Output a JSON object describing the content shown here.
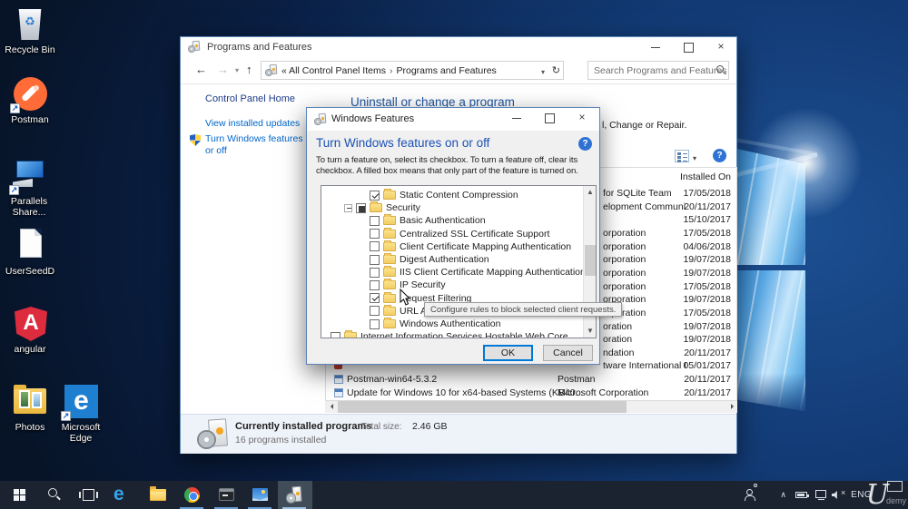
{
  "desktop": {
    "icons": [
      {
        "label": "Recycle Bin",
        "icon": "recycle-bin",
        "shortcut": false
      },
      {
        "label": "Postman",
        "icon": "postman",
        "shortcut": true
      },
      {
        "label": "Parallels Share...",
        "icon": "parallels",
        "shortcut": true
      },
      {
        "label": "UserSeedD",
        "icon": "document",
        "shortcut": false
      },
      {
        "label": "angular",
        "icon": "angular",
        "shortcut": false
      },
      {
        "label": "Photos",
        "icon": "photos",
        "shortcut": false
      },
      {
        "label": "Microsoft Edge",
        "icon": "edge",
        "shortcut": true
      }
    ]
  },
  "window": {
    "title": "Programs and Features",
    "nav": {
      "breadcrumb_root": "« All Control Panel Items",
      "breadcrumb_sep": "›",
      "breadcrumb_current": "Programs and Features",
      "search_placeholder": "Search Programs and Features"
    },
    "sidebar": {
      "home": "Control Panel Home",
      "view_updates": "View installed updates",
      "turn_features": "Turn Windows features on or off"
    },
    "main": {
      "heading": "Uninstall or change a program",
      "uninstall_hint_fragment": "l, Change or Repair.",
      "installed_on": "Installed On",
      "rows": [
        {
          "publisher": "for SQLite Team",
          "date": "17/05/2018",
          "icon": null,
          "name": ""
        },
        {
          "publisher": "elopment Communi",
          "date": "20/11/2017",
          "icon": null,
          "name": ""
        },
        {
          "publisher": "",
          "date": "15/10/2017",
          "icon": null,
          "name": ""
        },
        {
          "publisher": "orporation",
          "date": "17/05/2018",
          "icon": null,
          "name": ""
        },
        {
          "publisher": "orporation",
          "date": "04/06/2018",
          "icon": null,
          "name": ""
        },
        {
          "publisher": "orporation",
          "date": "19/07/2018",
          "icon": null,
          "name": ""
        },
        {
          "publisher": "orporation",
          "date": "19/07/2018",
          "icon": null,
          "name": ""
        },
        {
          "publisher": "orporation",
          "date": "17/05/2018",
          "icon": null,
          "name": ""
        },
        {
          "publisher": "orporation",
          "date": "19/07/2018",
          "icon": null,
          "name": ""
        },
        {
          "publisher": "orporation",
          "date": "17/05/2018",
          "icon": null,
          "name": ""
        },
        {
          "publisher": "oration",
          "date": "19/07/2018",
          "icon": null,
          "name": ""
        },
        {
          "publisher": "oration",
          "date": "19/07/2018",
          "icon": null,
          "name": ""
        },
        {
          "publisher": "ndation",
          "date": "20/11/2017",
          "icon": null,
          "name": ""
        },
        {
          "publisher": "tware International I",
          "date": "05/01/2017",
          "icon": "red",
          "name": ""
        },
        {
          "publisher": "Postman",
          "date": "20/11/2017",
          "icon": "app",
          "name": "Postman-win64-5.3.2"
        },
        {
          "publisher": "Microsoft Corporation",
          "date": "20/11/2017",
          "icon": "app",
          "name": "Update for Windows 10 for x64-based Systems (KB40..."
        }
      ],
      "footer": {
        "title": "Currently installed programs",
        "size_label": "Total size:",
        "size_value": "2.46 GB",
        "count": "16 programs installed"
      }
    }
  },
  "dialog": {
    "title": "Windows Features",
    "heading": "Turn Windows features on or off",
    "help": "?",
    "description": "To turn a feature on, select its checkbox. To turn a feature off, clear its checkbox. A filled box means that only part of the feature is turned on.",
    "tree": [
      {
        "label": "Static Content Compression",
        "level": 2,
        "state": "checked",
        "expander": null
      },
      {
        "label": "Security",
        "level": 1,
        "state": "partial",
        "expander": "minus"
      },
      {
        "label": "Basic Authentication",
        "level": 2,
        "state": "unchecked",
        "expander": null
      },
      {
        "label": "Centralized SSL Certificate Support",
        "level": 2,
        "state": "unchecked",
        "expander": null
      },
      {
        "label": "Client Certificate Mapping Authentication",
        "level": 2,
        "state": "unchecked",
        "expander": null
      },
      {
        "label": "Digest Authentication",
        "level": 2,
        "state": "unchecked",
        "expander": null
      },
      {
        "label": "IIS Client Certificate Mapping Authentication",
        "level": 2,
        "state": "unchecked",
        "expander": null
      },
      {
        "label": "IP Security",
        "level": 2,
        "state": "unchecked",
        "expander": null
      },
      {
        "label": "Request Filtering",
        "level": 2,
        "state": "checked",
        "expander": null
      },
      {
        "label": "URL Authorization",
        "level": 2,
        "state": "unchecked",
        "expander": null
      },
      {
        "label": "Windows Authentication",
        "level": 2,
        "state": "unchecked",
        "expander": null
      },
      {
        "label": "Internet Information Services Hostable Web Core",
        "level": 0,
        "state": "unchecked",
        "expander": null
      }
    ],
    "buttons": {
      "ok": "OK",
      "cancel": "Cancel"
    }
  },
  "tooltip": {
    "text": "Configure rules to block selected client requests."
  },
  "taskbar": {
    "language": "ENG",
    "apps": [
      {
        "name": "start",
        "running": false,
        "active": false
      },
      {
        "name": "search",
        "running": false,
        "active": false
      },
      {
        "name": "task-view",
        "running": false,
        "active": false
      },
      {
        "name": "edge",
        "running": false,
        "active": false
      },
      {
        "name": "file-explorer",
        "running": false,
        "active": false
      },
      {
        "name": "chrome",
        "running": true,
        "active": false
      },
      {
        "name": "terminal",
        "running": true,
        "active": false
      },
      {
        "name": "parallels",
        "running": true,
        "active": false
      },
      {
        "name": "windows-features",
        "running": true,
        "active": true
      }
    ]
  },
  "watermark": {
    "u": "U",
    "rest": "demy"
  }
}
